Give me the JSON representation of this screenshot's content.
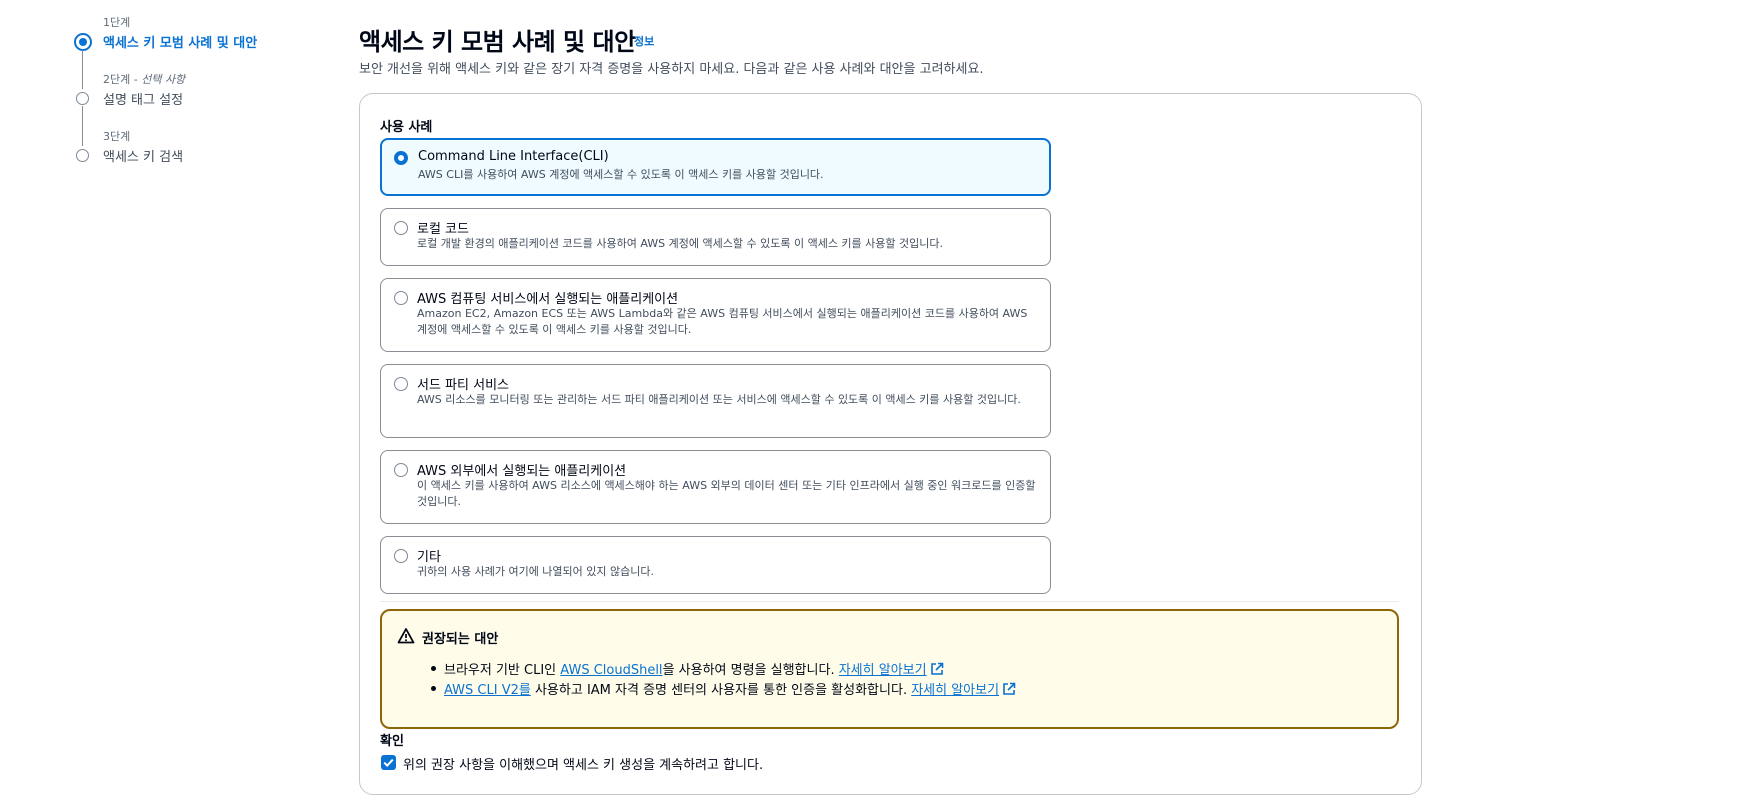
{
  "wizard": {
    "steps": [
      {
        "number": "1단계",
        "optional": "",
        "title": "액세스 키 모범 사례 및 대안"
      },
      {
        "number": "2단계 - ",
        "optional": "선택 사항",
        "title": "설명 태그 설정"
      },
      {
        "number": "3단계",
        "optional": "",
        "title": "액세스 키 검색"
      }
    ]
  },
  "header": {
    "title": "액세스 키 모범 사례 및 대안",
    "info": "정보",
    "description": "보안 개선을 위해 액세스 키와 같은 장기 자격 증명을 사용하지 마세요. 다음과 같은 사용 사례와 대안을 고려하세요."
  },
  "use_cases": {
    "label": "사용 사례",
    "selected_index": 0,
    "options": [
      {
        "title": "Command Line Interface(CLI)",
        "desc": "AWS CLI를 사용하여 AWS 계정에 액세스할 수 있도록 이 액세스 키를 사용할 것입니다."
      },
      {
        "title": "로컬 코드",
        "desc": "로컬 개발 환경의 애플리케이션 코드를 사용하여 AWS 계정에 액세스할 수 있도록 이 액세스 키를 사용할 것입니다."
      },
      {
        "title": "AWS 컴퓨팅 서비스에서 실행되는 애플리케이션",
        "desc": "Amazon EC2, Amazon ECS 또는 AWS Lambda와 같은 AWS 컴퓨팅 서비스에서 실행되는 애플리케이션 코드를 사용하여 AWS 계정에 액세스할 수 있도록 이 액세스 키를 사용할 것입니다."
      },
      {
        "title": "서드 파티 서비스",
        "desc": "AWS 리소스를 모니터링 또는 관리하는 서드 파티 애플리케이션 또는 서비스에 액세스할 수 있도록 이 액세스 키를 사용할 것입니다."
      },
      {
        "title": "AWS 외부에서 실행되는 애플리케이션",
        "desc": "이 액세스 키를 사용하여 AWS 리소스에 액세스해야 하는 AWS 외부의 데이터 센터 또는 기타 인프라에서 실행 중인 워크로드를 인증할 것입니다."
      },
      {
        "title": "기타",
        "desc": "귀하의 사용 사례가 여기에 나열되어 있지 않습니다."
      }
    ]
  },
  "alert": {
    "title": "권장되는 대안",
    "item1": {
      "prefix": "브라우저 기반 CLI인 ",
      "link": "AWS CloudShell",
      "suffix": "을 사용하여 명령을 실행합니다. ",
      "learn_more": "자세히 알아보기"
    },
    "item2": {
      "link": "AWS CLI V2를",
      "suffix": " 사용하고 IAM 자격 증명 센터의 사용자를 통한 인증을 활성화합니다. ",
      "learn_more": "자세히 알아보기"
    }
  },
  "confirmation": {
    "label": "확인",
    "checked": true,
    "text": "위의 권장 사항을 이해했으며 액세스 키 생성을 계속하려고 합니다."
  },
  "colors": {
    "accent": "#0972d3",
    "warning_border": "#8d6605",
    "warning_bg": "#fffce9"
  }
}
